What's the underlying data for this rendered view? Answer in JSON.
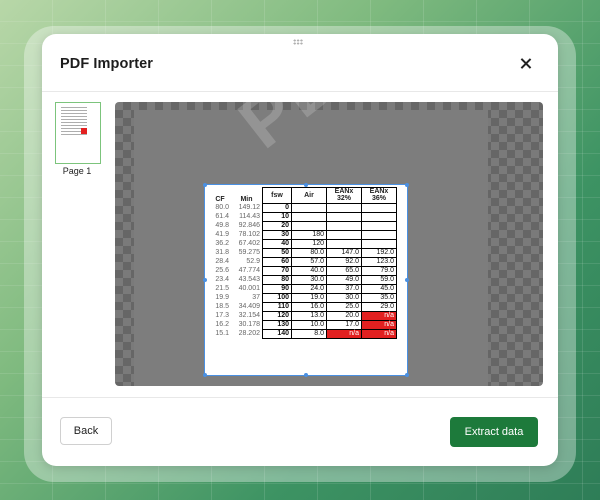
{
  "modal": {
    "title": "PDF Importer",
    "close_icon": "close-icon"
  },
  "sidebar": {
    "pages": [
      {
        "label": "Page 1",
        "selected": true
      }
    ]
  },
  "preview": {
    "watermark": "PDF",
    "table": {
      "headers": {
        "cf": "CF",
        "min": "Min",
        "fsw": "fsw",
        "air": "Air",
        "ean32": "EANx 32%",
        "ean36": "EANx 36%"
      },
      "rows": [
        [
          "80.0",
          "149.12",
          "0",
          "",
          "",
          ""
        ],
        [
          "61.4",
          "114.43",
          "10",
          "",
          "",
          ""
        ],
        [
          "49.8",
          "92.846",
          "20",
          "",
          "",
          ""
        ],
        [
          "41.9",
          "78.102",
          "30",
          "180",
          "",
          ""
        ],
        [
          "36.2",
          "67.402",
          "40",
          "120",
          "",
          ""
        ],
        [
          "31.8",
          "59.275",
          "50",
          "80.0",
          "147.0",
          "192.0"
        ],
        [
          "28.4",
          "52.9",
          "60",
          "57.0",
          "92.0",
          "123.0"
        ],
        [
          "25.6",
          "47.774",
          "70",
          "40.0",
          "65.0",
          "79.0"
        ],
        [
          "23.4",
          "43.543",
          "80",
          "30.0",
          "49.0",
          "59.0"
        ],
        [
          "21.5",
          "40.001",
          "90",
          "24.0",
          "37.0",
          "45.0"
        ],
        [
          "19.9",
          "37",
          "100",
          "19.0",
          "30.0",
          "35.0"
        ],
        [
          "18.5",
          "34.409",
          "110",
          "16.0",
          "25.0",
          "29.0"
        ],
        [
          "17.3",
          "32.154",
          "120",
          "13.0",
          "20.0",
          "n/a"
        ],
        [
          "16.2",
          "30.178",
          "130",
          "10.0",
          "17.0",
          "n/a"
        ],
        [
          "15.1",
          "28.202",
          "140",
          "8.0",
          "n/a",
          "n/a"
        ]
      ]
    }
  },
  "footer": {
    "back_label": "Back",
    "extract_label": "Extract data"
  },
  "colors": {
    "primary": "#1d7a3b",
    "selection": "#4a90e2",
    "na_cell": "#e22020"
  }
}
